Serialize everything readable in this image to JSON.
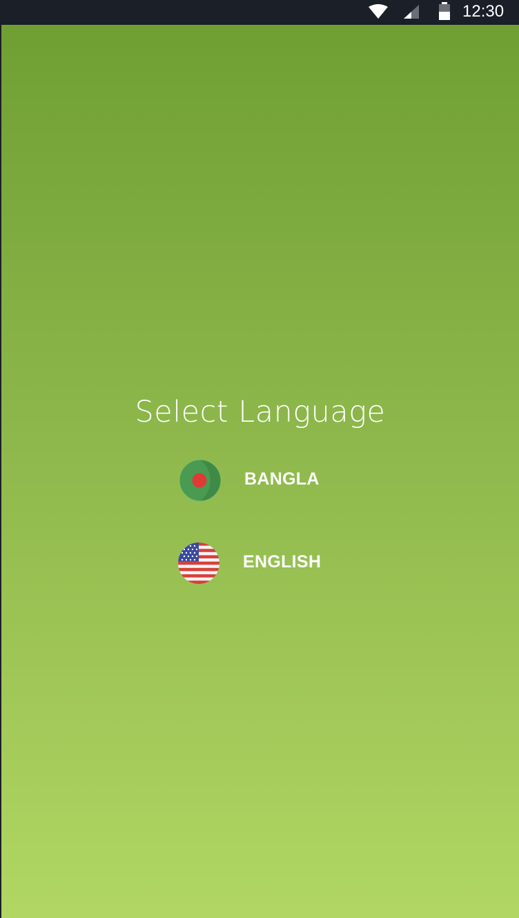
{
  "status_bar": {
    "time": "12:30",
    "icons": [
      "wifi-icon",
      "cellular-signal-icon",
      "battery-icon"
    ]
  },
  "screen": {
    "title": "Select Language",
    "gradient_top": "#6f9f33",
    "gradient_bottom": "#b1d663"
  },
  "languages": [
    {
      "label": "BANGLA",
      "icon": "bangladesh-flag-icon"
    },
    {
      "label": "ENGLISH",
      "icon": "usa-flag-icon"
    }
  ]
}
